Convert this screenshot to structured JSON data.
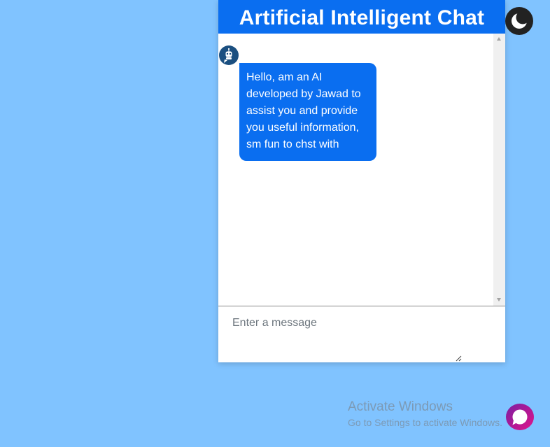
{
  "header": {
    "title": "Artificial Intelligent Chat"
  },
  "messages": [
    {
      "sender": "bot",
      "avatar_icon": "robot-icon",
      "text": "Hello, am an AI developed by Jawad to assist you and provide you useful information, sm fun to chst with"
    }
  ],
  "composer": {
    "placeholder": "Enter a message",
    "value": ""
  },
  "theme_toggle": {
    "icon": "moon-icon"
  },
  "launcher": {
    "icon": "chat-bubble-icon",
    "gradient": [
      "#7b1fa2",
      "#e0148a"
    ]
  },
  "watermark": {
    "title": "Activate Windows",
    "subtitle": "Go to Settings to activate Windows."
  },
  "colors": {
    "page_background": "#80c3ff",
    "accent": "#0a6ef0",
    "toggle_background": "#222222"
  }
}
